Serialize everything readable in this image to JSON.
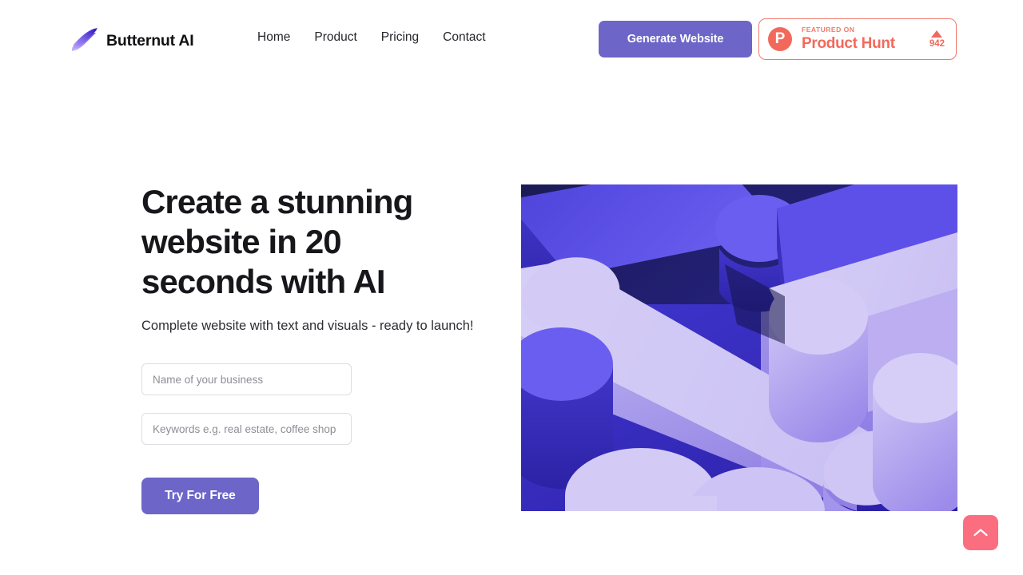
{
  "brand": {
    "name": "Butternut AI",
    "logo_icon": "wing-logo-icon",
    "logo_gradient_from": "#c9b8f7",
    "logo_gradient_to": "#4a2fe0"
  },
  "nav": {
    "items": [
      {
        "label": "Home"
      },
      {
        "label": "Product"
      },
      {
        "label": "Pricing"
      },
      {
        "label": "Contact"
      }
    ]
  },
  "header": {
    "cta_label": "Generate Website",
    "cta_color": "#6d65c8"
  },
  "product_hunt": {
    "kicker": "FEATURED ON",
    "title": "Product Hunt",
    "logo_letter": "P",
    "upvote_icon": "triangle-up-icon",
    "upvote_count": "942",
    "accent_color": "#f2695c"
  },
  "hero": {
    "title": "Create a stunning website in 20 seconds with AI",
    "subtitle": "Complete website with text and visuals - ready to launch!",
    "fields": [
      {
        "name": "business",
        "value": "",
        "placeholder": "Name of your business"
      },
      {
        "name": "keywords",
        "value": "",
        "placeholder": "Keywords e.g. real estate, coffee shop"
      }
    ],
    "submit_label": "Try For Free",
    "submit_color": "#6d65c8",
    "image_alt": "abstract-3d-purple-capsules"
  },
  "scroll_top": {
    "icon": "chevron-up-icon",
    "color": "#fa6e7f"
  }
}
